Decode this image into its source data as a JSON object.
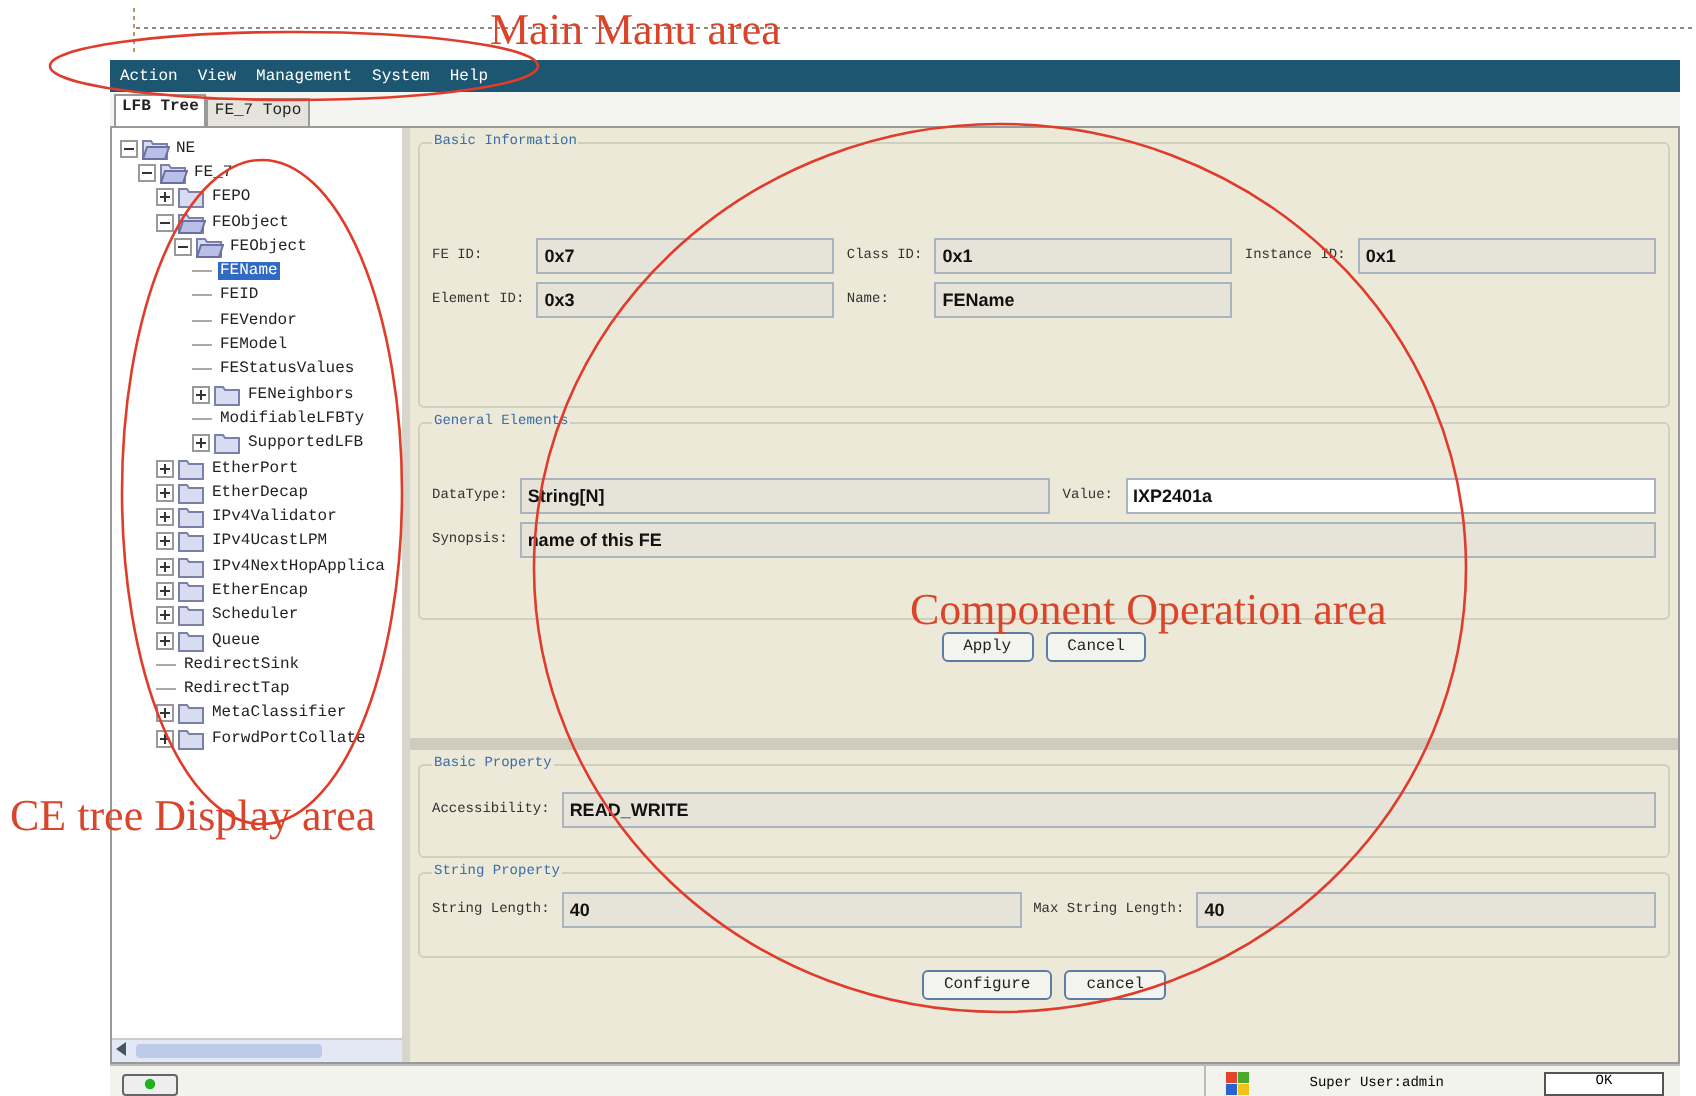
{
  "annotations": [
    {
      "text": "Main Manu area"
    },
    {
      "text": "Component Operation area"
    },
    {
      "text": "CE tree Display area"
    }
  ],
  "menu_bar": {
    "items": [
      "Action",
      "View",
      "Management",
      "System",
      "Help"
    ]
  },
  "tabs": [
    {
      "label": "LFB Tree",
      "selected": true
    },
    {
      "label": "FE_7 Topo",
      "selected": false
    }
  ],
  "tree": {
    "items": [
      {
        "label": "NE",
        "kind": "folder",
        "expanded": true,
        "selected": false,
        "children": [
          {
            "label": "FE_7",
            "kind": "folder",
            "expanded": true,
            "selected": false,
            "children": [
              {
                "label": "FEPO",
                "kind": "folder",
                "expanded": false,
                "selected": false
              },
              {
                "label": "FEObject",
                "kind": "folder",
                "expanded": true,
                "selected": false,
                "children": [
                  {
                    "label": "FEObject",
                    "kind": "folder",
                    "expanded": true,
                    "selected": false,
                    "children": [
                      {
                        "label": "FEName",
                        "kind": "leaf",
                        "selected": true
                      },
                      {
                        "label": "FEID",
                        "kind": "leaf",
                        "selected": false
                      },
                      {
                        "label": "FEVendor",
                        "kind": "leaf",
                        "selected": false
                      },
                      {
                        "label": "FEModel",
                        "kind": "leaf",
                        "selected": false
                      },
                      {
                        "label": "FEStatusValues",
                        "kind": "leaf",
                        "selected": false
                      },
                      {
                        "label": "FENeighbors",
                        "kind": "folder",
                        "expanded": false,
                        "selected": false
                      },
                      {
                        "label": "ModifiableLFBTy",
                        "kind": "leaf",
                        "selected": false
                      },
                      {
                        "label": "SupportedLFB",
                        "kind": "folder",
                        "expanded": false,
                        "selected": false
                      }
                    ]
                  }
                ]
              },
              {
                "label": "EtherPort",
                "kind": "folder",
                "expanded": false,
                "selected": false
              },
              {
                "label": "EtherDecap",
                "kind": "folder",
                "expanded": false,
                "selected": false
              },
              {
                "label": "IPv4Validator",
                "kind": "folder",
                "expanded": false,
                "selected": false
              },
              {
                "label": "IPv4UcastLPM",
                "kind": "folder",
                "expanded": false,
                "selected": false
              },
              {
                "label": "IPv4NextHopApplica",
                "kind": "folder",
                "expanded": false,
                "selected": false
              },
              {
                "label": "EtherEncap",
                "kind": "folder",
                "expanded": false,
                "selected": false
              },
              {
                "label": "Scheduler",
                "kind": "folder",
                "expanded": false,
                "selected": false
              },
              {
                "label": "Queue",
                "kind": "folder",
                "expanded": false,
                "selected": false
              },
              {
                "label": "RedirectSink",
                "kind": "leaf",
                "selected": false
              },
              {
                "label": "RedirectTap",
                "kind": "leaf",
                "selected": false
              },
              {
                "label": "MetaClassifier",
                "kind": "folder",
                "expanded": false,
                "selected": false
              },
              {
                "label": "ForwdPortCollate",
                "kind": "folder",
                "expanded": false,
                "selected": false
              }
            ]
          }
        ]
      }
    ]
  },
  "upper_form": {
    "sections": [
      {
        "title": "Basic Information",
        "rows": [
          [
            {
              "label": "FE ID:",
              "value": "0x7",
              "editable": false
            },
            {
              "label": "Class ID:",
              "value": "0x1",
              "editable": false
            },
            {
              "label": "Instance ID:",
              "value": "0x1",
              "editable": false
            }
          ],
          [
            {
              "label": "Element ID:",
              "value": "0x3",
              "editable": false
            },
            {
              "label": "Name:",
              "value": "FEName",
              "editable": false
            }
          ]
        ]
      },
      {
        "title": "General Elements",
        "rows": [
          [
            {
              "label": "DataType:",
              "value": "String[N]",
              "editable": false
            },
            {
              "label": "Value:",
              "value": "IXP2401a",
              "editable": true
            }
          ],
          [
            {
              "label": "Synopsis:",
              "value": "name of this FE",
              "editable": false
            }
          ]
        ]
      }
    ],
    "buttons": [
      "Apply",
      "Cancel"
    ]
  },
  "lower_form": {
    "sections": [
      {
        "title": "Basic Property",
        "rows": [
          [
            {
              "label": "Accessibility:",
              "value": "READ_WRITE",
              "editable": false
            }
          ]
        ]
      },
      {
        "title": "String Property",
        "rows": [
          [
            {
              "label": "String Length:",
              "value": "40",
              "editable": false
            },
            {
              "label": "Max String Length:",
              "value": "40",
              "editable": false
            }
          ]
        ]
      }
    ],
    "buttons": [
      "Configure",
      "cancel"
    ]
  },
  "status_bar": {
    "user": "Super User:admin",
    "status": "OK"
  }
}
